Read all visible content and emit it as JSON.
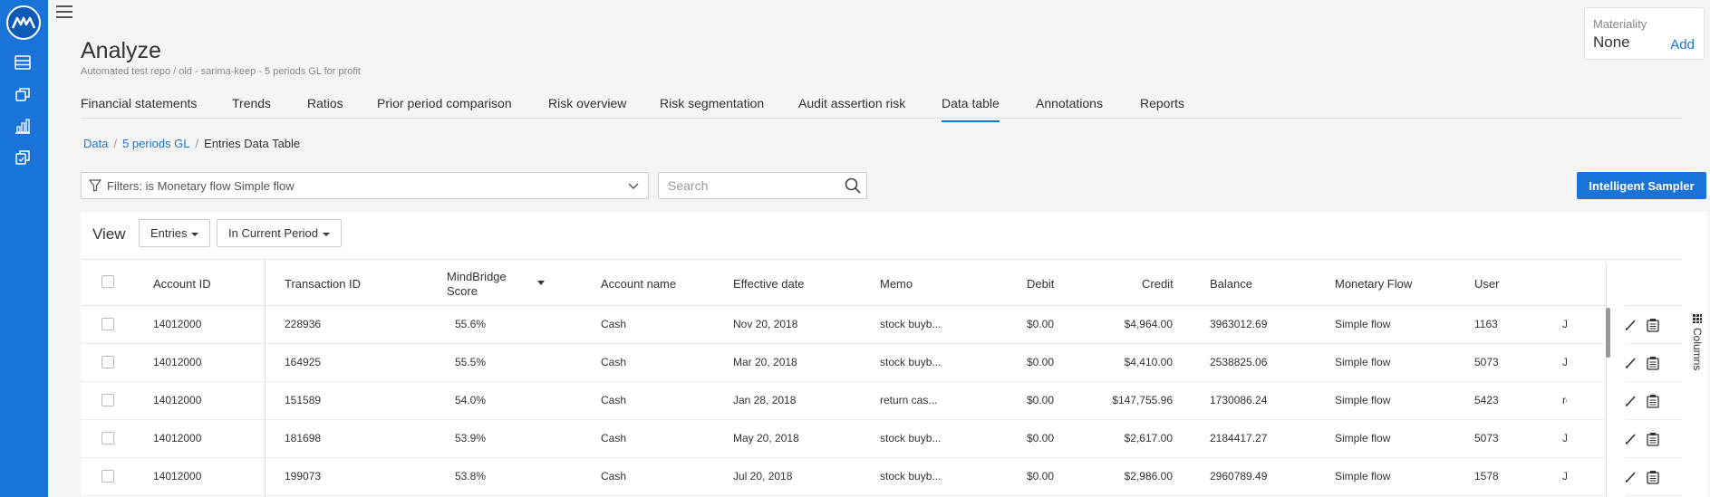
{
  "header": {
    "title": "Analyze",
    "subtitle": "Automated test repo / old - sarima-keep - 5 periods GL for profit"
  },
  "materiality": {
    "label": "Materiality",
    "value": "None",
    "add_label": "Add"
  },
  "tabs": [
    {
      "label": "Financial statements",
      "active": false
    },
    {
      "label": "Trends",
      "active": false
    },
    {
      "label": "Ratios",
      "active": false
    },
    {
      "label": "Prior period comparison",
      "active": false
    },
    {
      "label": "Risk overview",
      "active": false
    },
    {
      "label": "Risk segmentation",
      "active": false
    },
    {
      "label": "Audit assertion risk",
      "active": false
    },
    {
      "label": "Data table",
      "active": true
    },
    {
      "label": "Annotations",
      "active": false
    },
    {
      "label": "Reports",
      "active": false
    }
  ],
  "breadcrumb": {
    "items": [
      "Data",
      "5 periods GL"
    ],
    "current": "Entries Data Table"
  },
  "filter": {
    "text": "Filters: is  Monetary flow Simple flow"
  },
  "search": {
    "placeholder": "Search"
  },
  "sampler_button": "Intelligent Sampler",
  "view": {
    "label": "View",
    "entries_label": "Entries",
    "period_label": "In Current Period"
  },
  "table": {
    "columns": [
      "Account ID",
      "Transaction ID",
      "MindBridge Score",
      "Account name",
      "Effective date",
      "Memo",
      "Debit",
      "Credit",
      "Balance",
      "Monetary Flow",
      "User"
    ],
    "rows": [
      {
        "account_id": "14012000",
        "transaction_id": "228936",
        "score": "55.6%",
        "account_name": "Cash",
        "date": "Nov 20, 2018",
        "memo": "stock buyb...",
        "debit": "$0.00",
        "credit": "$4,964.00",
        "balance": "3963012.69",
        "flow": "Simple flow",
        "user": "1163",
        "extra": "JE"
      },
      {
        "account_id": "14012000",
        "transaction_id": "164925",
        "score": "55.5%",
        "account_name": "Cash",
        "date": "Mar 20, 2018",
        "memo": "stock buyb...",
        "debit": "$0.00",
        "credit": "$4,410.00",
        "balance": "2538825.06",
        "flow": "Simple flow",
        "user": "5073",
        "extra": "JE"
      },
      {
        "account_id": "14012000",
        "transaction_id": "151589",
        "score": "54.0%",
        "account_name": "Cash",
        "date": "Jan 28, 2018",
        "memo": "return cas...",
        "debit": "$0.00",
        "credit": "$147,755.96",
        "balance": "1730086.24",
        "flow": "Simple flow",
        "user": "5423",
        "extra": "re"
      },
      {
        "account_id": "14012000",
        "transaction_id": "181698",
        "score": "53.9%",
        "account_name": "Cash",
        "date": "May 20, 2018",
        "memo": "stock buyb...",
        "debit": "$0.00",
        "credit": "$2,617.00",
        "balance": "2184417.27",
        "flow": "Simple flow",
        "user": "5073",
        "extra": "JE"
      },
      {
        "account_id": "14012000",
        "transaction_id": "199073",
        "score": "53.8%",
        "account_name": "Cash",
        "date": "Jul 20, 2018",
        "memo": "stock buyb...",
        "debit": "$0.00",
        "credit": "$2,986.00",
        "balance": "2960789.49",
        "flow": "Simple flow",
        "user": "1578",
        "extra": "JE"
      }
    ]
  },
  "columns_tab": "Columns",
  "colors": {
    "accent": "#1a73d9",
    "sidebar": "#1a73d9"
  }
}
